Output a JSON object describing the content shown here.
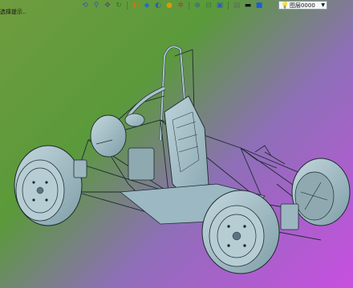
{
  "status_hint": "选择提示..",
  "toolbar": {
    "buttons": [
      {
        "name": "view-orient-icon",
        "glyph": "⟲",
        "color": "#2f5fa8"
      },
      {
        "name": "zoom-icon",
        "glyph": "⚲",
        "color": "#2f5fa8"
      },
      {
        "name": "pan-icon",
        "glyph": "✥",
        "color": "#556"
      },
      {
        "name": "rotate-icon",
        "glyph": "↻",
        "color": "#2a7a2a"
      },
      {
        "name": "section-view-icon",
        "glyph": "◧",
        "color": "#c07a10"
      },
      {
        "name": "display-style-icon",
        "glyph": "◆",
        "color": "#1e6ec8"
      },
      {
        "name": "hide-show-icon",
        "glyph": "◐",
        "color": "#2f5fa8"
      },
      {
        "name": "appearance-icon",
        "glyph": "●",
        "color": "#d89a00"
      },
      {
        "name": "scene-icon",
        "glyph": "✲",
        "color": "#a04040"
      },
      {
        "name": "view-settings-icon",
        "glyph": "⊕",
        "color": "#2f5fa8"
      },
      {
        "name": "measure-icon",
        "glyph": "⊟",
        "color": "#3a7a3a"
      },
      {
        "name": "render-icon",
        "glyph": "▣",
        "color": "#2f5fa8"
      },
      {
        "name": "display-pane-icon",
        "glyph": "▤",
        "color": "#666"
      },
      {
        "name": "line-style-icon",
        "glyph": "▬",
        "color": "#111"
      },
      {
        "name": "color-swatch-icon",
        "glyph": "■",
        "color": "#1a5fd0"
      }
    ]
  },
  "layer": {
    "label": "图层0000",
    "bulb_icon": "lightbulb-icon",
    "arrow_icon": "chevron-down-icon"
  },
  "colors": {
    "model": "#a9c3cc",
    "model_dark": "#6f8e98",
    "edge": "#1d2a30"
  }
}
